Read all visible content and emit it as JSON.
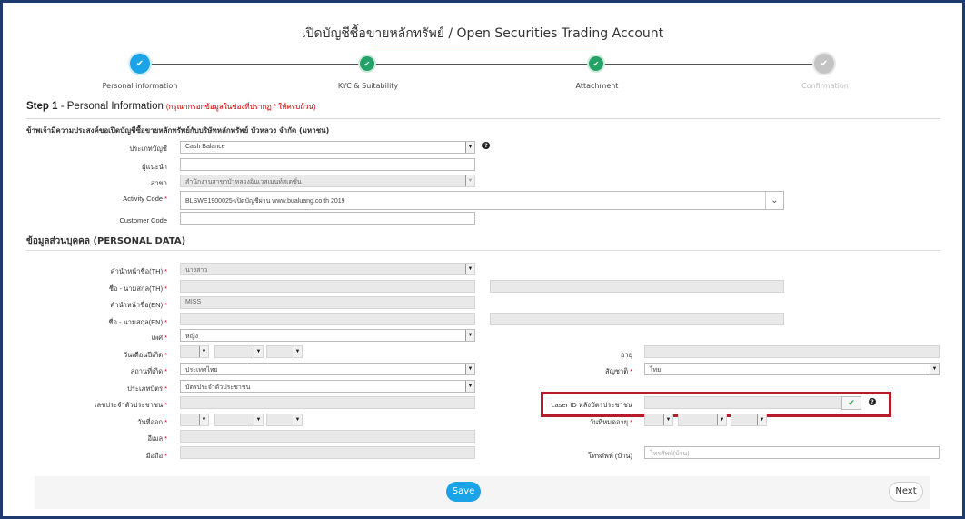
{
  "page": {
    "title": "เปิดบัญชีซื้อขายหลักทรัพย์ / Open Securities Trading Account"
  },
  "wizard": {
    "steps": [
      {
        "label": "Personal information",
        "state": "current"
      },
      {
        "label": "KYC & Suitability",
        "state": "done"
      },
      {
        "label": "Attachment",
        "state": "done"
      },
      {
        "label": "Confirmation",
        "state": "pending"
      }
    ],
    "check_icon": "✔"
  },
  "step": {
    "prefix": "Step 1",
    "sep": " - ",
    "title": "Personal Information",
    "hint": "(กรุณากรอกข้อมูลในช่องที่ปรากฏ * ให้ครบถ้วน)"
  },
  "account": {
    "intro": "ข้าพเจ้ามีความประสงค์ขอเปิดบัญชีซื้อขายหลักทรัพย์กับบริษัทหลักทรัพย์ บัวหลวง จำกัด (มหาชน)",
    "account_type": {
      "label": "ประเภทบัญชี",
      "value": "Cash Balance"
    },
    "referrer": {
      "label": "ผู้แนะนำ",
      "value": ""
    },
    "branch": {
      "label": "สาขา",
      "value": "สำนักงานสาขาบัวหลวงอินเวสเมนท์สเตชั่น"
    },
    "activity_code": {
      "label": "Activity Code",
      "value": "BLSWE1900025-เปิดบัญชีผ่าน www.bualuang.co.th 2019"
    },
    "customer_code": {
      "label": "Customer Code",
      "value": ""
    }
  },
  "personal": {
    "section_title": "ข้อมูลส่วนบุคคล (PERSONAL DATA)",
    "title_th": {
      "label": "คำนำหน้าชื่อ(TH)",
      "value": "นางสาว"
    },
    "name_th": {
      "label": "ชื่อ - นามสกุล(TH)"
    },
    "title_en": {
      "label": "คำนำหน้าชื่อ(EN)",
      "value": "MISS"
    },
    "name_en": {
      "label": "ชื่อ - นามสกุล(EN)"
    },
    "gender": {
      "label": "เพศ",
      "value": "หญิง"
    },
    "birth_date": {
      "label": "วันเดือนปีเกิด"
    },
    "age": {
      "label": "อายุ"
    },
    "birth_place": {
      "label": "สถานที่เกิด",
      "value": "ประเทศไทย"
    },
    "nationality": {
      "label": "สัญชาติ",
      "value": "ไทย"
    },
    "card_type": {
      "label": "ประเภทบัตร",
      "value": "บัตรประจำตัวประชาชน"
    },
    "id_number": {
      "label": "เลขประจำตัวประชาชน"
    },
    "laser_id": {
      "label": "Laser ID หลังบัตรประชาชน"
    },
    "issue_date": {
      "label": "วันที่ออก"
    },
    "expiry_date": {
      "label": "วันที่หมดอายุ"
    },
    "email": {
      "label": "อีเมล"
    },
    "mobile": {
      "label": "มือถือ"
    },
    "home_phone": {
      "label": "โทรศัพท์ (บ้าน)",
      "placeholder": "โทรศัพท์(บ้าน)"
    }
  },
  "actions": {
    "save": "Save",
    "next": "Next"
  },
  "symbols": {
    "required": "*",
    "help": "?",
    "dropdown": "▼",
    "chevron": "⌄"
  },
  "colors": {
    "accent": "#1aa3e6",
    "done": "#23a267",
    "pending": "#bdbdbd",
    "required": "#dd0000",
    "highlight_box": "#b71c2c",
    "frame": "#1f3a6e"
  }
}
